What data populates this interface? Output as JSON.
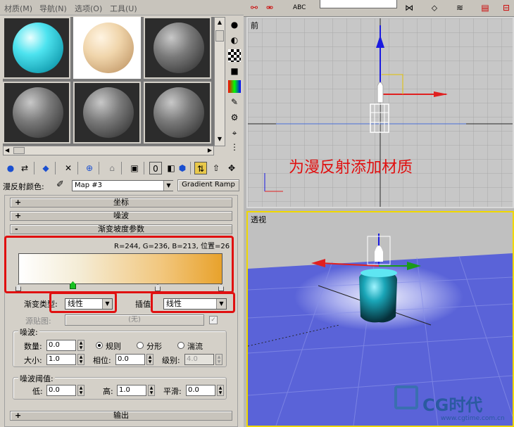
{
  "menu": [
    "材质(M)",
    "导航(N)",
    "选项(O)",
    "工具(U)"
  ],
  "map_row": {
    "label": "漫反射颜色:",
    "map_name": "Map #3",
    "map_type": "Gradient Ramp"
  },
  "rollouts": {
    "coords": "坐标",
    "noise": "噪波",
    "gradient_params": "渐变坡度参数",
    "output": "输出"
  },
  "gradient": {
    "readout": "R=244, G=236, B=213, 位置=26",
    "colors": [
      "#ffffff",
      "#f4ecd5",
      "#e8a22c"
    ]
  },
  "gradient_type": {
    "label": "渐变类型:",
    "value": "线性"
  },
  "interpolation": {
    "label": "插值:",
    "value": "线性"
  },
  "source_map": {
    "label": "源贴图:",
    "value": "(无)"
  },
  "noise_group": {
    "title": "噪波:",
    "amount_label": "数量:",
    "amount": "0.0",
    "size_label": "大小:",
    "size": "1.0",
    "phase_label": "相位:",
    "phase": "0.0",
    "levels_label": "级别:",
    "levels": "4.0",
    "regular": "规则",
    "fractal": "分形",
    "turbulence": "湍流"
  },
  "threshold_group": {
    "title": "噪波阈值:",
    "low_label": "低:",
    "low": "0.0",
    "high_label": "高:",
    "high": "1.0",
    "smooth_label": "平滑:",
    "smooth": "0.0"
  },
  "viewports": {
    "front_label": "前",
    "annotation": "为漫反射添加材质",
    "persp_label": "透视"
  },
  "watermark": {
    "logo": "CG时代",
    "url": "www.cgtime.com.cn"
  },
  "colors": {
    "annotation": "#e01010",
    "persp_border": "#f0d800",
    "ground": "#5a63d8"
  }
}
